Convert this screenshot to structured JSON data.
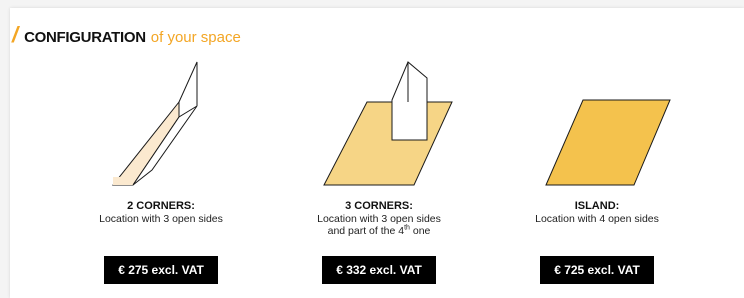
{
  "header": {
    "slash": "/",
    "title_strong": "CONFIGURATION",
    "title_light": "of your space"
  },
  "options": [
    {
      "title": "2 CORNERS:",
      "desc_line1": "Location with 3 open sides",
      "price": "€ 275 excl. VAT"
    },
    {
      "title": "3 CORNERS:",
      "desc_line1": "Location with 3 open sides",
      "desc_line2_pre": "and part of the 4",
      "desc_line2_sup": "th",
      "desc_line2_post": " one",
      "price": "€ 332 excl. VAT"
    },
    {
      "title": "ISLAND:",
      "desc_line1": "Location with 4 open sides",
      "price": "€ 725 excl. VAT"
    }
  ],
  "colors": {
    "accent": "#f3a625",
    "floor_light": "#fbe9cf",
    "floor_medium": "#f6d586",
    "floor_dark": "#f4c24d",
    "price_bg": "#000000"
  }
}
